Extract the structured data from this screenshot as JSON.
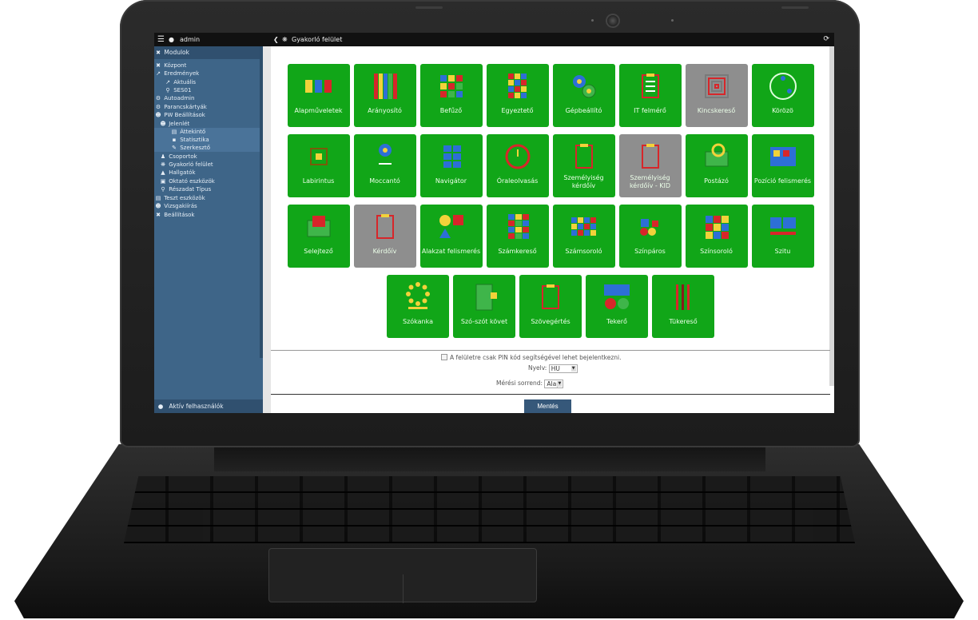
{
  "topbar": {
    "user": "admin",
    "breadcrumb": "Gyakorló felület",
    "menu_icon": "hamburger-icon",
    "refresh_icon": "refresh-icon"
  },
  "sidebar": {
    "header": "Modulok",
    "items": [
      {
        "label": "Központ",
        "icon": "hub-icon"
      },
      {
        "label": "Eredmények",
        "icon": "chart-icon"
      },
      {
        "label": "Aktuális",
        "icon": "chart-icon"
      },
      {
        "label": "SES01",
        "icon": "pin-icon"
      },
      {
        "label": "Autoadmin",
        "icon": "gear-icon"
      },
      {
        "label": "Parancskártyák",
        "icon": "gear-icon"
      },
      {
        "label": "PW Beállítások",
        "icon": "users-icon"
      },
      {
        "label": "Jelenlét",
        "icon": "users-icon"
      },
      {
        "label": "Áttekintő",
        "icon": "doc-icon"
      },
      {
        "label": "Statisztika",
        "icon": "bar-chart-icon"
      },
      {
        "label": "Szerkesztő",
        "icon": "edit-icon"
      },
      {
        "label": "Csoportok",
        "icon": "group-icon"
      },
      {
        "label": "Gyakorló felület",
        "icon": "brain-icon"
      },
      {
        "label": "Hallgatók",
        "icon": "cap-icon"
      },
      {
        "label": "Oktató eszközök",
        "icon": "monitor-icon"
      },
      {
        "label": "Részadat Típus",
        "icon": "keys-icon"
      },
      {
        "label": "Teszt eszközök",
        "icon": "doc-icon"
      },
      {
        "label": "Vizsgakiírás",
        "icon": "people-icon"
      },
      {
        "label": "Beállítások",
        "icon": "hub-icon"
      }
    ],
    "footer": "Aktív felhasználók"
  },
  "tiles": [
    {
      "label": "Alapműveletek",
      "grey": false
    },
    {
      "label": "Arányosító",
      "grey": false
    },
    {
      "label": "Befűző",
      "grey": false
    },
    {
      "label": "Egyeztető",
      "grey": false
    },
    {
      "label": "Gépbeállító",
      "grey": false
    },
    {
      "label": "IT felmérő",
      "grey": false
    },
    {
      "label": "Kincskereső",
      "grey": true
    },
    {
      "label": "Körözö",
      "grey": false
    },
    {
      "label": "Labirintus",
      "grey": false
    },
    {
      "label": "Moccantó",
      "grey": false
    },
    {
      "label": "Navigátor",
      "grey": false
    },
    {
      "label": "Óraleolvasás",
      "grey": false
    },
    {
      "label": "Személyiség kérdőív",
      "grey": false
    },
    {
      "label": "Személyiség kérdőív - KID",
      "grey": true
    },
    {
      "label": "Postázó",
      "grey": false
    },
    {
      "label": "Pozíció felismerés",
      "grey": false
    },
    {
      "label": "Selejtező",
      "grey": false
    },
    {
      "label": "Kérdőív",
      "grey": true
    },
    {
      "label": "Alakzat felismerés",
      "grey": false
    },
    {
      "label": "Számkereső",
      "grey": false
    },
    {
      "label": "Számsoroló",
      "grey": false
    },
    {
      "label": "Színpáros",
      "grey": false
    },
    {
      "label": "Színsoroló",
      "grey": false
    },
    {
      "label": "Szitu",
      "grey": false
    },
    {
      "label": "Szókanka",
      "grey": false
    },
    {
      "label": "Szó-szót követ",
      "grey": false
    },
    {
      "label": "Szövegértés",
      "grey": false
    },
    {
      "label": "Tekerő",
      "grey": false
    },
    {
      "label": "Tükereső",
      "grey": false
    }
  ],
  "options": {
    "pin_label": "A felületre csak PIN kód segítségével lehet bejelentkezni.",
    "language_label": "Nyelv:",
    "language_value": "HU",
    "order_label": "Mérési sorrend:",
    "order_value": "Alap",
    "save_label": "Mentés"
  },
  "colors": {
    "tile_green": "#11a618",
    "tile_grey": "#8e8e8e",
    "sidebar": "#3e6588",
    "save_button": "#36587a"
  }
}
